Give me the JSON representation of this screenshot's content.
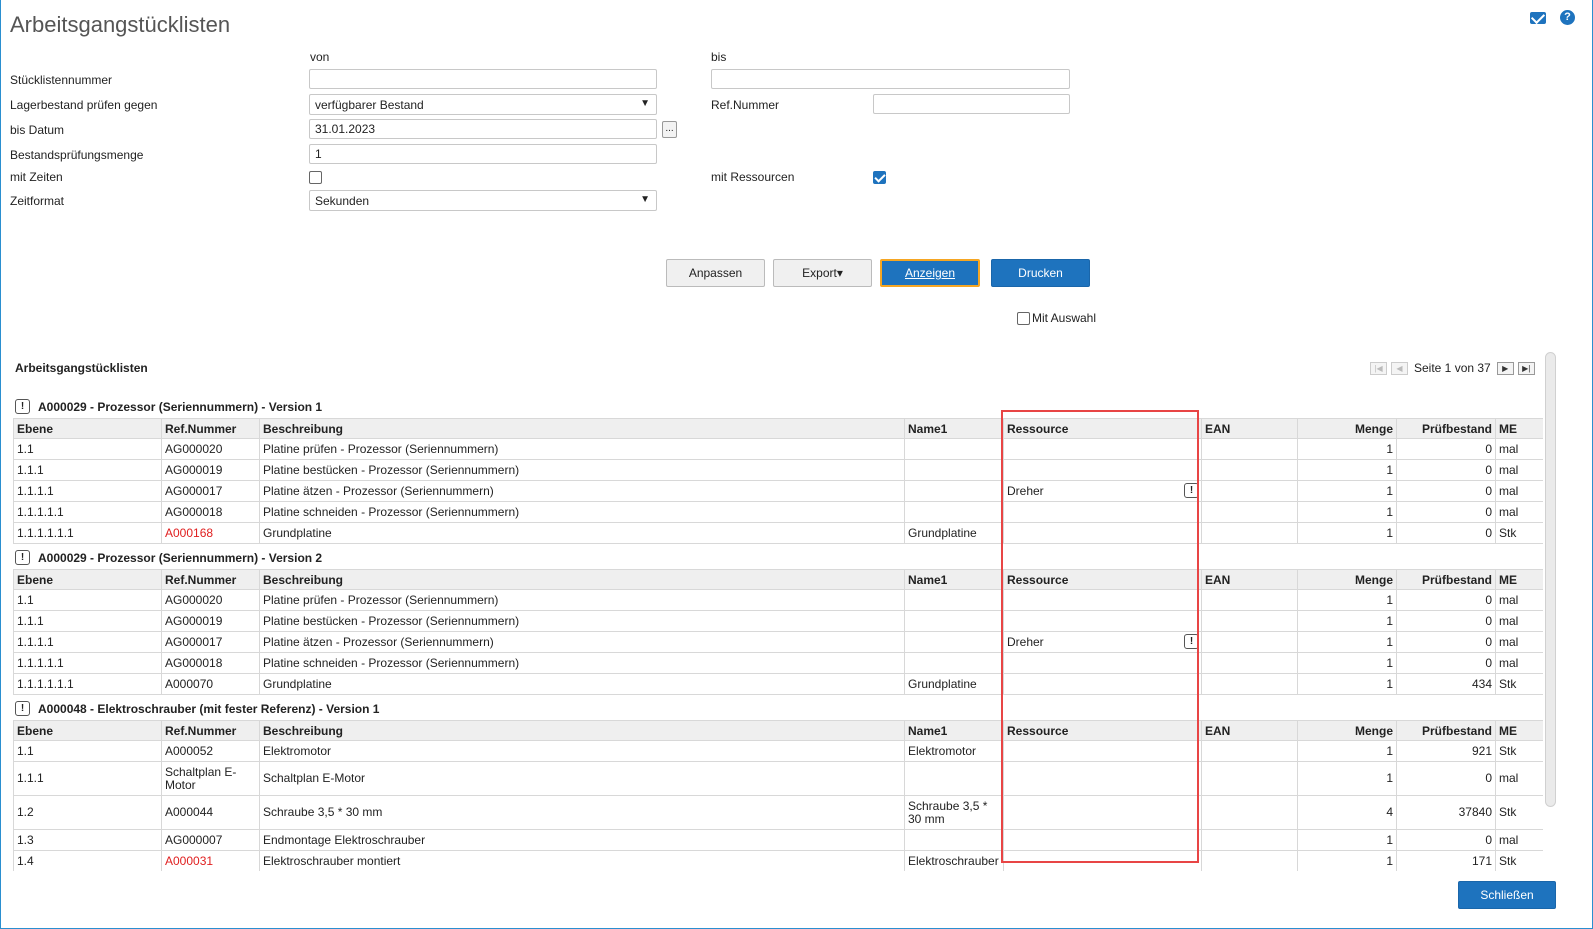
{
  "page": {
    "title": "Arbeitsgangstücklisten"
  },
  "form": {
    "von_label": "von",
    "bis_label": "bis",
    "stuecklistennummer_label": "Stücklistennummer",
    "stuecklistennummer_von": "",
    "stuecklistennummer_bis": "",
    "lagerbestand_label": "Lagerbestand prüfen gegen",
    "lagerbestand_value": "verfügbarer Bestand",
    "refnummer_label": "Ref.Nummer",
    "refnummer_value": "",
    "bis_datum_label": "bis Datum",
    "bis_datum_value": "31.01.2023",
    "dots_label": "...",
    "bestandspruefungsmenge_label": "Bestandsprüfungsmenge",
    "bestandspruefungsmenge_value": "1",
    "mit_zeiten_label": "mit Zeiten",
    "mit_zeiten_checked": false,
    "mit_ressourcen_label": "mit Ressourcen",
    "mit_ressourcen_checked": true,
    "zeitformat_label": "Zeitformat",
    "zeitformat_value": "Sekunden"
  },
  "buttons": {
    "anpassen": "Anpassen",
    "export": "Export▾",
    "anzeigen": "Anzeigen",
    "drucken": "Drucken",
    "mit_auswahl": "Mit Auswahl",
    "schliessen": "Schließen"
  },
  "list": {
    "title": "Arbeitsgangstücklisten",
    "pager_text": "Seite 1 von 37",
    "columns": [
      "Ebene",
      "Ref.Nummer",
      "Beschreibung",
      "Name1",
      "Ressource",
      "EAN",
      "Menge",
      "Prüfbestand",
      "ME"
    ],
    "groups": [
      {
        "title": "A000029 - Prozessor (Seriennummern) - Version 1",
        "rows": [
          {
            "ebene": "1.1",
            "ref": "AG000020",
            "ref_red": false,
            "desc": "Platine prüfen - Prozessor (Seriennummern)",
            "name1": "",
            "ressource": "",
            "res_icon": false,
            "ean": "",
            "menge": "1",
            "pruef": "0",
            "me": "mal"
          },
          {
            "ebene": "1.1.1",
            "ref": "AG000019",
            "ref_red": false,
            "desc": "Platine bestücken - Prozessor (Seriennummern)",
            "name1": "",
            "ressource": "",
            "res_icon": false,
            "ean": "",
            "menge": "1",
            "pruef": "0",
            "me": "mal"
          },
          {
            "ebene": "1.1.1.1",
            "ref": "AG000017",
            "ref_red": false,
            "desc": "Platine ätzen - Prozessor (Seriennummern)",
            "name1": "",
            "ressource": "Dreher",
            "res_icon": true,
            "ean": "",
            "menge": "1",
            "pruef": "0",
            "me": "mal"
          },
          {
            "ebene": "1.1.1.1.1",
            "ref": "AG000018",
            "ref_red": false,
            "desc": "Platine schneiden - Prozessor (Seriennummern)",
            "name1": "",
            "ressource": "",
            "res_icon": false,
            "ean": "",
            "menge": "1",
            "pruef": "0",
            "me": "mal"
          },
          {
            "ebene": "1.1.1.1.1.1",
            "ref": "A000168",
            "ref_red": true,
            "desc": "Grundplatine",
            "name1": "Grundplatine",
            "ressource": "",
            "res_icon": false,
            "ean": "",
            "menge": "1",
            "pruef": "0",
            "me": "Stk"
          }
        ]
      },
      {
        "title": "A000029 - Prozessor (Seriennummern) - Version 2",
        "rows": [
          {
            "ebene": "1.1",
            "ref": "AG000020",
            "ref_red": false,
            "desc": "Platine prüfen - Prozessor (Seriennummern)",
            "name1": "",
            "ressource": "",
            "res_icon": false,
            "ean": "",
            "menge": "1",
            "pruef": "0",
            "me": "mal"
          },
          {
            "ebene": "1.1.1",
            "ref": "AG000019",
            "ref_red": false,
            "desc": "Platine bestücken - Prozessor (Seriennummern)",
            "name1": "",
            "ressource": "",
            "res_icon": false,
            "ean": "",
            "menge": "1",
            "pruef": "0",
            "me": "mal"
          },
          {
            "ebene": "1.1.1.1",
            "ref": "AG000017",
            "ref_red": false,
            "desc": "Platine ätzen - Prozessor (Seriennummern)",
            "name1": "",
            "ressource": "Dreher",
            "res_icon": true,
            "ean": "",
            "menge": "1",
            "pruef": "0",
            "me": "mal"
          },
          {
            "ebene": "1.1.1.1.1",
            "ref": "AG000018",
            "ref_red": false,
            "desc": "Platine schneiden - Prozessor (Seriennummern)",
            "name1": "",
            "ressource": "",
            "res_icon": false,
            "ean": "",
            "menge": "1",
            "pruef": "0",
            "me": "mal"
          },
          {
            "ebene": "1.1.1.1.1.1",
            "ref": "A000070",
            "ref_red": false,
            "desc": "Grundplatine",
            "name1": "Grundplatine",
            "ressource": "",
            "res_icon": false,
            "ean": "",
            "menge": "1",
            "pruef": "434",
            "me": "Stk"
          }
        ]
      },
      {
        "title": "A000048 - Elektroschrauber (mit fester Referenz) - Version 1",
        "rows": [
          {
            "ebene": "1.1",
            "ref": "A000052",
            "ref_red": false,
            "desc": "Elektromotor",
            "name1": "Elektromotor",
            "ressource": "",
            "res_icon": false,
            "ean": "",
            "menge": "1",
            "pruef": "921",
            "me": "Stk"
          },
          {
            "ebene": "1.1.1",
            "ref": "Schaltplan E-Motor",
            "ref_red": false,
            "desc": "Schaltplan E-Motor",
            "name1": "",
            "ressource": "",
            "res_icon": false,
            "ean": "",
            "menge": "1",
            "pruef": "0",
            "me": "mal",
            "tall": true
          },
          {
            "ebene": "1.2",
            "ref": "A000044",
            "ref_red": false,
            "desc": "Schraube 3,5 * 30 mm",
            "name1": "Schraube 3,5 * 30 mm",
            "ressource": "",
            "res_icon": false,
            "ean": "",
            "menge": "4",
            "pruef": "37840",
            "me": "Stk",
            "tall": true
          },
          {
            "ebene": "1.3",
            "ref": "AG000007",
            "ref_red": false,
            "desc": "Endmontage Elektroschrauber",
            "name1": "",
            "ressource": "",
            "res_icon": false,
            "ean": "",
            "menge": "1",
            "pruef": "0",
            "me": "mal"
          },
          {
            "ebene": "1.4",
            "ref": "A000031",
            "ref_red": true,
            "desc": "Elektroschrauber montiert",
            "name1": "Elektroschrauber",
            "ressource": "",
            "res_icon": false,
            "ean": "",
            "menge": "1",
            "pruef": "171",
            "me": "Stk"
          }
        ]
      }
    ]
  }
}
